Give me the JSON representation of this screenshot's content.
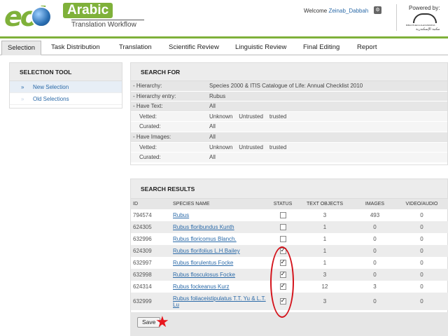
{
  "logo": {
    "brand": "eol",
    "product": "Arabic",
    "subtitle": "Translation Workflow"
  },
  "header": {
    "welcome_label": "Welcome",
    "username": "Zeinab_Dabbah",
    "powered_by": "Powered by:",
    "partner_name_en": "BIBLIOTHECA ALEXANDRINA",
    "partner_name_ar": "مكتبة الإسكندرية"
  },
  "nav": {
    "tabs": [
      {
        "label": "Selection",
        "active": true
      },
      {
        "label": "Task Distribution"
      },
      {
        "label": "Translation"
      },
      {
        "label": "Scientific Review"
      },
      {
        "label": "Linguistic Review"
      },
      {
        "label": "Final Editing"
      },
      {
        "label": "Report"
      }
    ]
  },
  "selection_tool": {
    "title": "SELECTION TOOL",
    "items": [
      {
        "label": "New Selection",
        "selected": true
      },
      {
        "label": "Old Selections"
      }
    ]
  },
  "search_for": {
    "title": "SEARCH FOR",
    "rows": [
      {
        "label": "- Hierarchy:",
        "value": "Species 2000 & ITIS Catalogue of Life: Annual Checklist 2010"
      },
      {
        "label": "- Hierarchy entry:",
        "value": "Rubus"
      },
      {
        "label": "- Have Text:",
        "value": "All"
      },
      {
        "label": "Vetted:",
        "value": "Unknown    Untrusted    trusted"
      },
      {
        "label": "Curated:",
        "value": "All"
      },
      {
        "label": "- Have Images:",
        "value": "All"
      },
      {
        "label": "Vetted:",
        "value": "Unknown    Untrusted    trusted"
      },
      {
        "label": "Curated:",
        "value": "All"
      }
    ]
  },
  "search_results": {
    "title": "SEARCH RESULTS",
    "columns": [
      "ID",
      "SPECIES NAME",
      "STATUS",
      "TEXT OBJECTS",
      "IMAGES",
      "VIDEO/AUDIO"
    ],
    "rows": [
      {
        "id": "794574",
        "name": "Rubus",
        "checked": false,
        "text": "3",
        "images": "493",
        "video": "0"
      },
      {
        "id": "624305",
        "name": "Rubus floribundus Kunth",
        "checked": false,
        "text": "1",
        "images": "0",
        "video": "0"
      },
      {
        "id": "632996",
        "name": "Rubus floricomus Blanch.",
        "checked": false,
        "text": "1",
        "images": "0",
        "video": "0"
      },
      {
        "id": "624309",
        "name": "Rubus florifolius L.H.Bailey",
        "checked": true,
        "text": "1",
        "images": "0",
        "video": "0"
      },
      {
        "id": "632997",
        "name": "Rubus florulentus Focke",
        "checked": true,
        "text": "1",
        "images": "0",
        "video": "0"
      },
      {
        "id": "632998",
        "name": "Rubus flosculosus Focke",
        "checked": true,
        "text": "3",
        "images": "0",
        "video": "0"
      },
      {
        "id": "624314",
        "name": "Rubus fockeanus Kurz",
        "checked": true,
        "text": "12",
        "images": "3",
        "video": "0"
      },
      {
        "id": "632999",
        "name": "Rubus foliaceistipulatus T.T. Yu & L.T. Lu",
        "checked": true,
        "text": "3",
        "images": "0",
        "video": "0"
      }
    ],
    "save_label": "Save"
  },
  "colors": {
    "brand_green": "#7fb13a",
    "link_blue": "#2b6aa8",
    "annotation_red": "#d4141c"
  },
  "icons": {
    "user": "user-settings-icon",
    "selection_arrow": "double-arrow-icon",
    "annotation": "red-star-icon"
  }
}
